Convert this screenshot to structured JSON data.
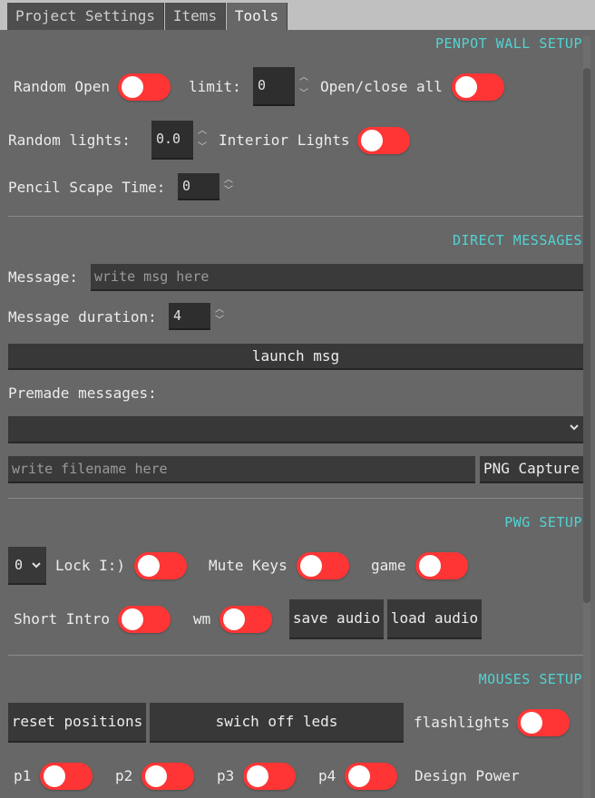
{
  "tabs": [
    {
      "label": "Project Settings"
    },
    {
      "label": "Items"
    },
    {
      "label": "Tools"
    }
  ],
  "penpot": {
    "title": "PENPOT WALL SETUP",
    "random_open_label": "Random Open",
    "limit_label": "limit:",
    "limit_value": "0",
    "open_close_all_label": "Open/close all",
    "random_lights_label": "Random lights:",
    "random_lights_value": "0.0",
    "interior_lights_label": "Interior Lights",
    "pencil_scape_label": "Pencil Scape Time:",
    "pencil_scape_value": "0"
  },
  "direct": {
    "title": "DIRECT MESSAGES",
    "message_label": "Message:",
    "message_placeholder": "write msg here",
    "duration_label": "Message duration:",
    "duration_value": "4",
    "launch_label": "launch msg",
    "premade_label": "Premade messages:",
    "premade_selected": "",
    "filename_placeholder": "write filename here",
    "png_capture_label": "PNG Capture"
  },
  "pwg": {
    "title": "PWG SETUP",
    "dropdown_value": "0",
    "lock_label": "Lock I:)",
    "mute_keys_label": "Mute Keys",
    "game_label": "game",
    "short_intro_label": "Short Intro",
    "wm_label": "wm",
    "save_audio_label": "save audio",
    "load_audio_label": "load audio"
  },
  "mouses": {
    "title": "MOUSES SETUP",
    "reset_label": "reset positions",
    "switch_off_leds_label": "swich off leds",
    "flashlights_label": "flashlights",
    "p1_label": "p1",
    "p2_label": "p2",
    "p3_label": "p3",
    "p4_label": "p4",
    "design_power_label": "Design Power"
  },
  "colors": {
    "accent": "#52d3d3",
    "toggle": "#ff3535",
    "panel_bg": "#676767"
  },
  "icons": {
    "spinner": "up-down-arrows",
    "dropdown": "chevron-down-icon"
  },
  "toggles_state": "off"
}
